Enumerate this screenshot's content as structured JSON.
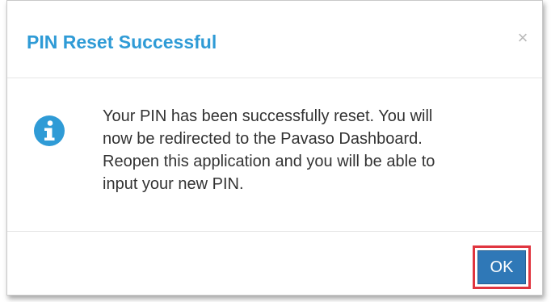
{
  "dialog": {
    "title": "PIN Reset Successful",
    "close_glyph": "×",
    "icon": "info-circle-icon",
    "message_lines": [
      "Your PIN has been successfully reset. You will",
      "now be redirected to the Pavaso Dashboard.",
      "Reopen this application and you will be able to",
      "input your new PIN."
    ],
    "ok_label": "OK"
  },
  "colors": {
    "title": "#2f9bd6",
    "info_icon": "#2f9bd6",
    "ok_button": "#2f78b7",
    "highlight": "#e0353f"
  }
}
